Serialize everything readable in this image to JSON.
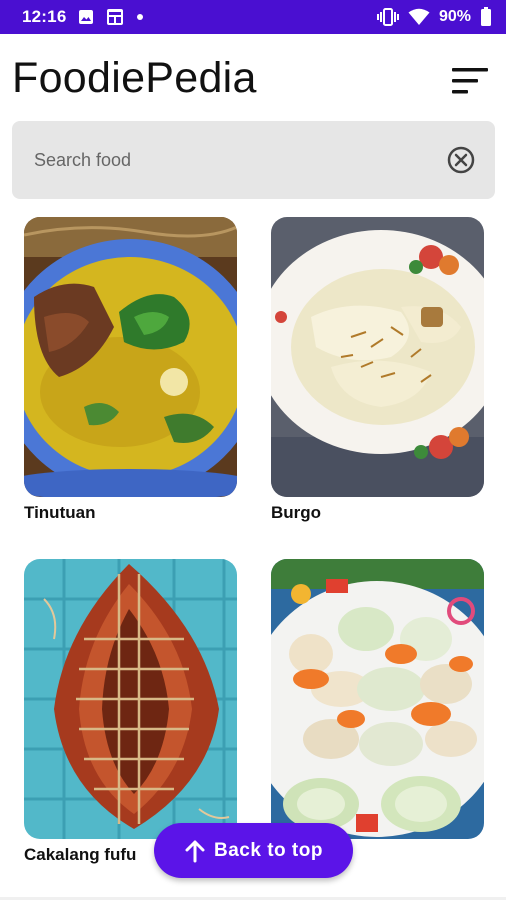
{
  "status_bar": {
    "time": "12:16",
    "battery_percent": "90%",
    "icons": [
      "image-icon",
      "notification-badge-icon",
      "dot-icon",
      "vibrate-icon",
      "wifi-icon",
      "battery-icon"
    ]
  },
  "header": {
    "title": "FoodiePedia",
    "sort_icon": "sort-lines-icon"
  },
  "search": {
    "placeholder": "Search food",
    "value": "",
    "clear_icon": "clear-circle-icon"
  },
  "foods": [
    {
      "name": "Tinutuan"
    },
    {
      "name": "Burgo"
    },
    {
      "name": "Cakalang fufu"
    },
    {
      "name": ""
    }
  ],
  "fab": {
    "label": "Back to top",
    "icon": "arrow-up-icon"
  },
  "colors": {
    "status_bar": "#4a0fd1",
    "accent": "#5b14e8",
    "search_bg": "#e6e6e6"
  }
}
